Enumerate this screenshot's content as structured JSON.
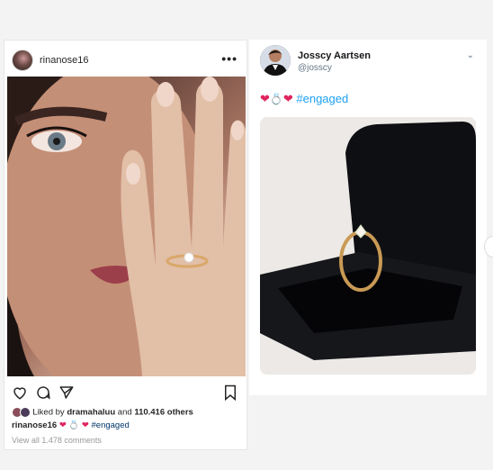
{
  "instagram": {
    "username": "rinanose16",
    "more_icon": "•••",
    "photo_alt": "Woman covering face with hand wearing engagement ring",
    "liked_prefix": "Liked by ",
    "liked_user": "dramahaluu",
    "liked_suffix": " and ",
    "liked_count": "110.416 others",
    "caption_user": "rinanose16",
    "caption_tag": "#engaged",
    "comments_link": "View all 1.478 comments",
    "icons": [
      "heart-icon",
      "comment-icon",
      "share-icon",
      "bookmark-icon"
    ]
  },
  "twitter": {
    "display_name": "Josscy Aartsen",
    "handle": "@josscy",
    "chevron": "⌄",
    "tweet_tag": "#engaged",
    "photo_alt": "Gold engagement ring in black velvet box"
  },
  "colors": {
    "heart": "#e0245e",
    "hashtag_twitter": "#1da1f2",
    "hashtag_instagram": "#003569"
  }
}
